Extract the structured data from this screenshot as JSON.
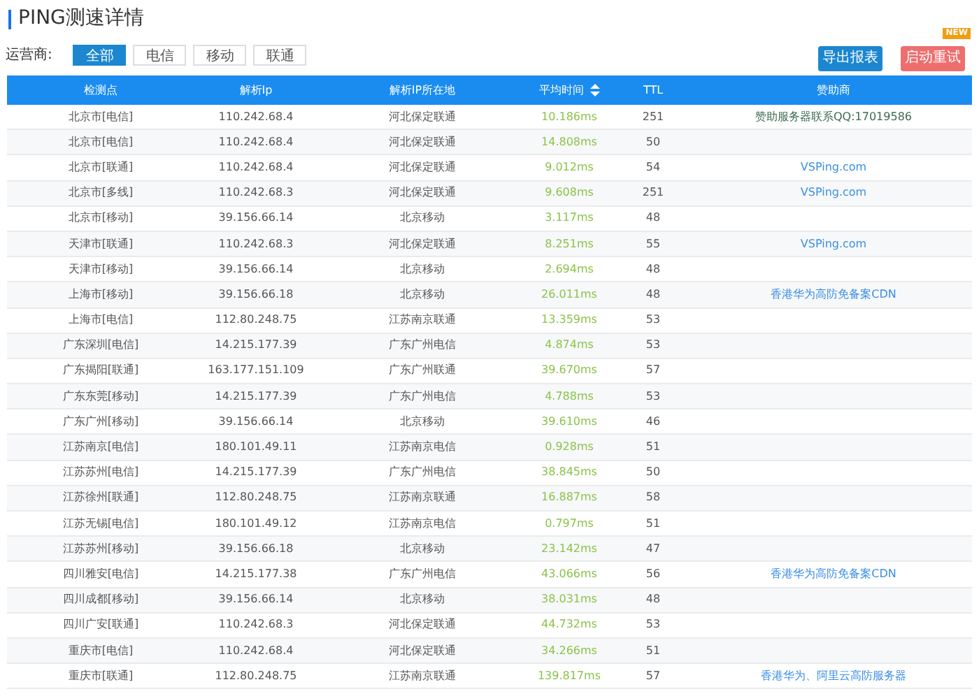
{
  "title": "PING测速详情",
  "filter": {
    "label": "运营商:",
    "options": [
      {
        "label": "全部",
        "selected": true
      },
      {
        "label": "电信",
        "selected": false
      },
      {
        "label": "移动",
        "selected": false
      },
      {
        "label": "联通",
        "selected": false
      }
    ]
  },
  "actions": [
    {
      "label": "导出报表",
      "kind": "primary"
    },
    {
      "label": "启动重试",
      "kind": "danger",
      "badge": "NEW"
    }
  ],
  "table": {
    "columns": [
      {
        "label": "检测点",
        "sortable": false
      },
      {
        "label": "解析Ip",
        "sortable": false
      },
      {
        "label": "解析IP所在地",
        "sortable": false
      },
      {
        "label": "平均时间",
        "sortable": true
      },
      {
        "label": "TTL",
        "sortable": false
      },
      {
        "label": "赞助商",
        "sortable": false
      }
    ],
    "rows": [
      {
        "node": "北京市[电信]",
        "ip": "110.242.68.4",
        "location": "河北保定联通",
        "avg": "10.186ms",
        "ttl": "251",
        "sponsor": {
          "kind": "text",
          "text": "赞助服务器联系QQ:17019586"
        }
      },
      {
        "node": "北京市[电信]",
        "ip": "110.242.68.4",
        "location": "河北保定联通",
        "avg": "14.808ms",
        "ttl": "50"
      },
      {
        "node": "北京市[联通]",
        "ip": "110.242.68.4",
        "location": "河北保定联通",
        "avg": "9.012ms",
        "ttl": "54",
        "sponsor": {
          "kind": "link",
          "text": "VSPing.com"
        }
      },
      {
        "node": "北京市[多线]",
        "ip": "110.242.68.3",
        "location": "河北保定联通",
        "avg": "9.608ms",
        "ttl": "251",
        "sponsor": {
          "kind": "link",
          "text": "VSPing.com"
        }
      },
      {
        "node": "北京市[移动]",
        "ip": "39.156.66.14",
        "location": "北京移动",
        "avg": "3.117ms",
        "ttl": "48"
      },
      {
        "node": "天津市[联通]",
        "ip": "110.242.68.3",
        "location": "河北保定联通",
        "avg": "8.251ms",
        "ttl": "55",
        "sponsor": {
          "kind": "link",
          "text": "VSPing.com"
        }
      },
      {
        "node": "天津市[移动]",
        "ip": "39.156.66.14",
        "location": "北京移动",
        "avg": "2.694ms",
        "ttl": "48"
      },
      {
        "node": "上海市[移动]",
        "ip": "39.156.66.18",
        "location": "北京移动",
        "avg": "26.011ms",
        "ttl": "48",
        "sponsor": {
          "kind": "link",
          "text": "香港华为高防免备案CDN"
        }
      },
      {
        "node": "上海市[电信]",
        "ip": "112.80.248.75",
        "location": "江苏南京联通",
        "avg": "13.359ms",
        "ttl": "53"
      },
      {
        "node": "广东深圳[电信]",
        "ip": "14.215.177.39",
        "location": "广东广州电信",
        "avg": "4.874ms",
        "ttl": "53"
      },
      {
        "node": "广东揭阳[联通]",
        "ip": "163.177.151.109",
        "location": "广东广州联通",
        "avg": "39.670ms",
        "ttl": "57"
      },
      {
        "node": "广东东莞[移动]",
        "ip": "14.215.177.39",
        "location": "广东广州电信",
        "avg": "4.788ms",
        "ttl": "53"
      },
      {
        "node": "广东广州[移动]",
        "ip": "39.156.66.14",
        "location": "北京移动",
        "avg": "39.610ms",
        "ttl": "46"
      },
      {
        "node": "江苏南京[电信]",
        "ip": "180.101.49.11",
        "location": "江苏南京电信",
        "avg": "0.928ms",
        "ttl": "51"
      },
      {
        "node": "江苏苏州[电信]",
        "ip": "14.215.177.39",
        "location": "广东广州电信",
        "avg": "38.845ms",
        "ttl": "50"
      },
      {
        "node": "江苏徐州[联通]",
        "ip": "112.80.248.75",
        "location": "江苏南京联通",
        "avg": "16.887ms",
        "ttl": "58"
      },
      {
        "node": "江苏无锡[电信]",
        "ip": "180.101.49.12",
        "location": "江苏南京电信",
        "avg": "0.797ms",
        "ttl": "51"
      },
      {
        "node": "江苏苏州[移动]",
        "ip": "39.156.66.18",
        "location": "北京移动",
        "avg": "23.142ms",
        "ttl": "47"
      },
      {
        "node": "四川雅安[电信]",
        "ip": "14.215.177.38",
        "location": "广东广州电信",
        "avg": "43.066ms",
        "ttl": "56",
        "sponsor": {
          "kind": "link",
          "text": "香港华为高防免备案CDN"
        }
      },
      {
        "node": "四川成都[移动]",
        "ip": "39.156.66.14",
        "location": "北京移动",
        "avg": "38.031ms",
        "ttl": "48"
      },
      {
        "node": "四川广安[联通]",
        "ip": "110.242.68.3",
        "location": "河北保定联通",
        "avg": "44.732ms",
        "ttl": "53"
      },
      {
        "node": "重庆市[电信]",
        "ip": "110.242.68.4",
        "location": "河北保定联通",
        "avg": "34.266ms",
        "ttl": "51"
      },
      {
        "node": "重庆市[联通]",
        "ip": "112.80.248.75",
        "location": "江苏南京联通",
        "avg": "139.817ms",
        "ttl": "57",
        "sponsor": {
          "kind": "link",
          "text": "香港华为、阿里云高防服务器"
        }
      }
    ]
  }
}
